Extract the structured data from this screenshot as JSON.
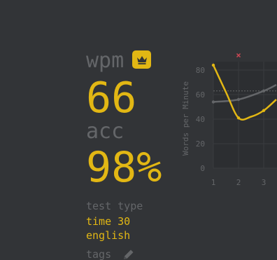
{
  "result": {
    "wpm_label": "wpm",
    "wpm_value": "66",
    "acc_label": "acc",
    "acc_value": "98%",
    "crown_icon": "crown-icon"
  },
  "more": {
    "test_type_label": "test type",
    "test_mode": "time 30",
    "test_language": "english",
    "tags_label": "tags",
    "edit_icon": "pencil-icon"
  },
  "colors": {
    "background": "#323437",
    "main": "#e2b714",
    "sub": "#646669",
    "error": "#ca4754",
    "raw_line": "#646669"
  },
  "chart_data": {
    "type": "line",
    "ylabel": "Words per Minute",
    "xlabel": "",
    "ylim": [
      0,
      80
    ],
    "yticks": [
      "0",
      "20",
      "40",
      "60",
      "80"
    ],
    "x": [
      1,
      2,
      3
    ],
    "xticks": [
      "1",
      "2",
      "3"
    ],
    "grid": true,
    "series": [
      {
        "role": "wpm",
        "color": "#e2b714",
        "points": [
          [
            1,
            84
          ],
          [
            1.5,
            62
          ],
          [
            2,
            41
          ],
          [
            2.5,
            42
          ],
          [
            3,
            47
          ],
          [
            3.5,
            56
          ]
        ]
      },
      {
        "role": "raw",
        "color": "#646669",
        "points": [
          [
            1,
            54
          ],
          [
            2,
            56
          ],
          [
            3,
            63
          ],
          [
            3.5,
            68
          ]
        ]
      }
    ],
    "average_line": 63,
    "errors": [
      [
        2,
        92
      ]
    ]
  }
}
